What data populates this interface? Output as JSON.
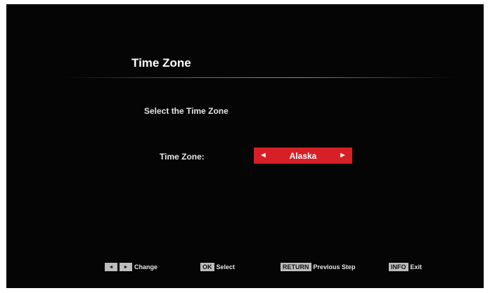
{
  "screen": {
    "title": "Time Zone",
    "subtitle": "Select the Time Zone",
    "field_label": "Time Zone:",
    "selector": {
      "value": "Alaska",
      "left_arrow": "◄",
      "right_arrow": "►",
      "color": "#d71f26"
    }
  },
  "footer": {
    "change": {
      "left_key": "◄",
      "right_key": "►",
      "label": "Change"
    },
    "select": {
      "key": "OK",
      "label": "Select"
    },
    "previous": {
      "key": "RETURN",
      "label": "Previous Step"
    },
    "exit": {
      "key": "INFO",
      "label": "Exit"
    }
  }
}
